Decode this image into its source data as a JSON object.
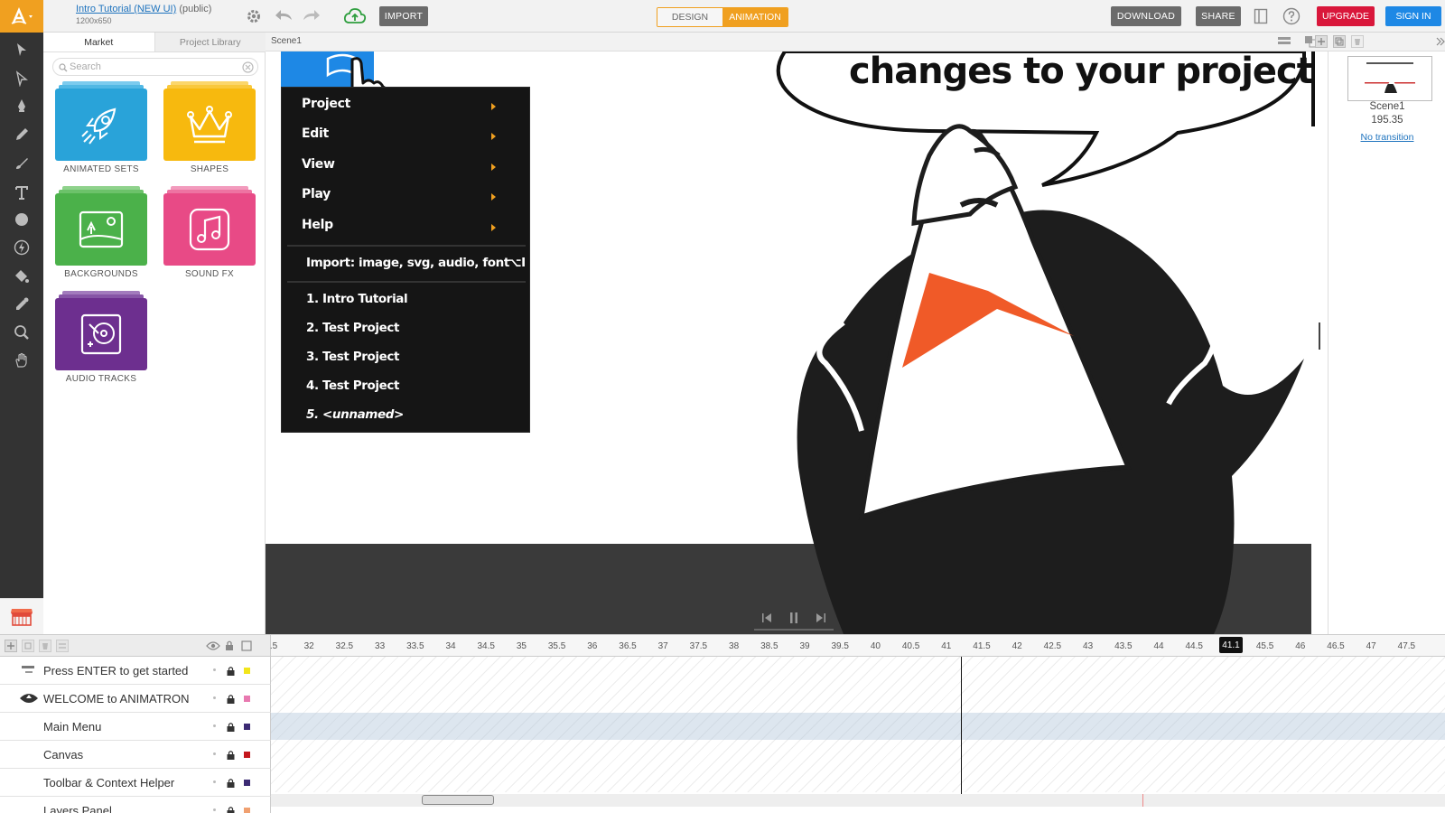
{
  "header": {
    "project_title": "Intro Tutorial (NEW UI)",
    "visibility": "(public)",
    "dimensions": "1200x650",
    "import_label": "IMPORT",
    "mode_design": "DESIGN",
    "mode_animation": "ANIMATION",
    "download_label": "DOWNLOAD",
    "share_label": "SHARE",
    "upgrade_label": "UPGRADE",
    "signin_label": "SIGN IN",
    "accent_color": "#f0a020"
  },
  "library": {
    "tab_market": "Market",
    "tab_project_library": "Project Library",
    "search_placeholder": "Search",
    "categories": [
      {
        "label": "ANIMATED SETS",
        "color": "#29a3d9",
        "icon": "rocket-icon"
      },
      {
        "label": "SHAPES",
        "color": "#f7b90e",
        "icon": "crown-icon"
      },
      {
        "label": "BACKGROUNDS",
        "color": "#4bb14a",
        "icon": "landscape-icon"
      },
      {
        "label": "SOUND FX",
        "color": "#e84a86",
        "icon": "music-note-icon"
      },
      {
        "label": "AUDIO TRACKS",
        "color": "#6d2f8f",
        "icon": "turntable-icon"
      }
    ]
  },
  "scene_bar": {
    "breadcrumb": "Scene1"
  },
  "stage": {
    "speech_text": "changes to your project!"
  },
  "main_menu": {
    "items": [
      "Project",
      "Edit",
      "View",
      "Play",
      "Help"
    ],
    "import_label": "Import: image, svg, audio, font",
    "import_shortcut": "⌥I",
    "recent": [
      "1. Intro Tutorial",
      "2. Test Project",
      "3. Test Project",
      "4. Test Project",
      "5. <unnamed>"
    ]
  },
  "scenes_panel": {
    "scene_name": "Scene1",
    "duration": "195.35",
    "transition": "No transition"
  },
  "timeline": {
    "current_time": "41.1",
    "ticks": [
      ".5",
      "32",
      "32.5",
      "33",
      "33.5",
      "34",
      "34.5",
      "35",
      "35.5",
      "36",
      "36.5",
      "37",
      "37.5",
      "38",
      "38.5",
      "39",
      "39.5",
      "40",
      "40.5",
      "41",
      "41.5",
      "42",
      "42.5",
      "43",
      "43.5",
      "44",
      "44.5",
      "45",
      "45.5",
      "46",
      "46.5",
      "47",
      "47.5"
    ],
    "layers": [
      {
        "name": "Press ENTER to get started",
        "color": "#f2e51a"
      },
      {
        "name": "WELCOME to ANIMATRON",
        "color": "#e879b0"
      },
      {
        "name": "Main Menu",
        "color": "#3b2a73"
      },
      {
        "name": "Canvas",
        "color": "#c4161c"
      },
      {
        "name": "Toolbar & Context Helper",
        "color": "#3b2a73"
      },
      {
        "name": "Layers Panel",
        "color": "#f0a070"
      }
    ]
  }
}
